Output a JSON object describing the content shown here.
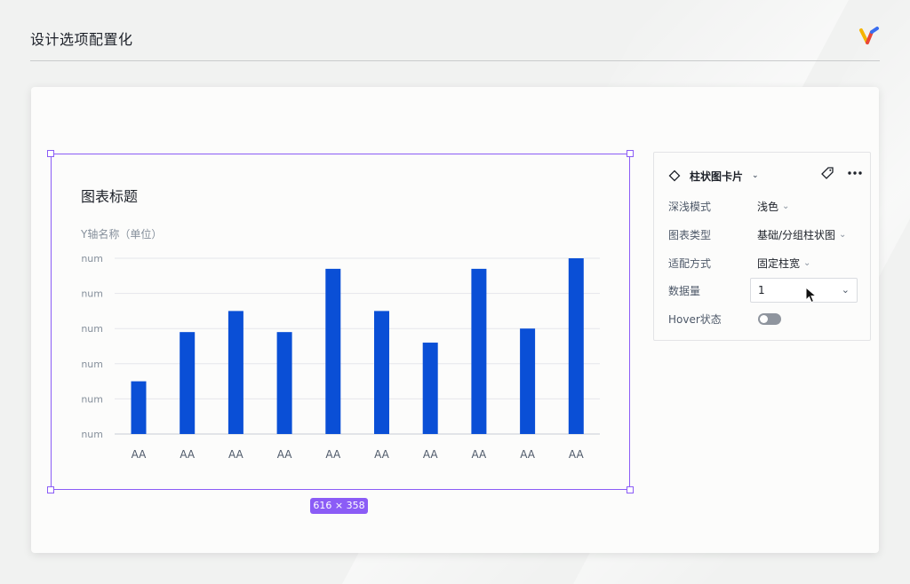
{
  "page": {
    "title": "设计选项配置化"
  },
  "selection": {
    "size_label": "616 × 358"
  },
  "chart_card": {
    "title": "图表标题",
    "y_axis_name": "Y轴名称（单位）"
  },
  "chart_data": {
    "type": "bar",
    "title": "图表标题",
    "ylabel": "Y轴名称（单位）",
    "xlabel": "",
    "categories": [
      "AA",
      "AA",
      "AA",
      "AA",
      "AA",
      "AA",
      "AA",
      "AA",
      "AA",
      "AA"
    ],
    "values": [
      1.5,
      2.9,
      3.5,
      2.9,
      4.7,
      3.5,
      2.6,
      4.7,
      3.0,
      5.0
    ],
    "ylim": [
      0,
      5
    ],
    "y_tick_labels": [
      "num",
      "num",
      "num",
      "num",
      "num",
      "num"
    ],
    "grid": true,
    "bar_color": "#0a4fd6"
  },
  "panel": {
    "component_name": "柱状图卡片",
    "rows": [
      {
        "label": "深浅模式",
        "value": "浅色"
      },
      {
        "label": "图表类型",
        "value": "基础/分组柱状图"
      },
      {
        "label": "适配方式",
        "value": "固定柱宽"
      }
    ],
    "data_count": {
      "label": "数据量",
      "value": "1"
    },
    "hover": {
      "label": "Hover状态",
      "enabled": false
    }
  },
  "colors": {
    "accent": "#8b5cf6",
    "bar": "#0a4fd6",
    "background": "#f1f2f1"
  },
  "icons": {
    "component": "diamond-icon",
    "tag": "tag-icon",
    "more": "more-dots-icon",
    "dropdown": "chevron-down-icon",
    "cursor": "pointer-cursor-icon"
  }
}
